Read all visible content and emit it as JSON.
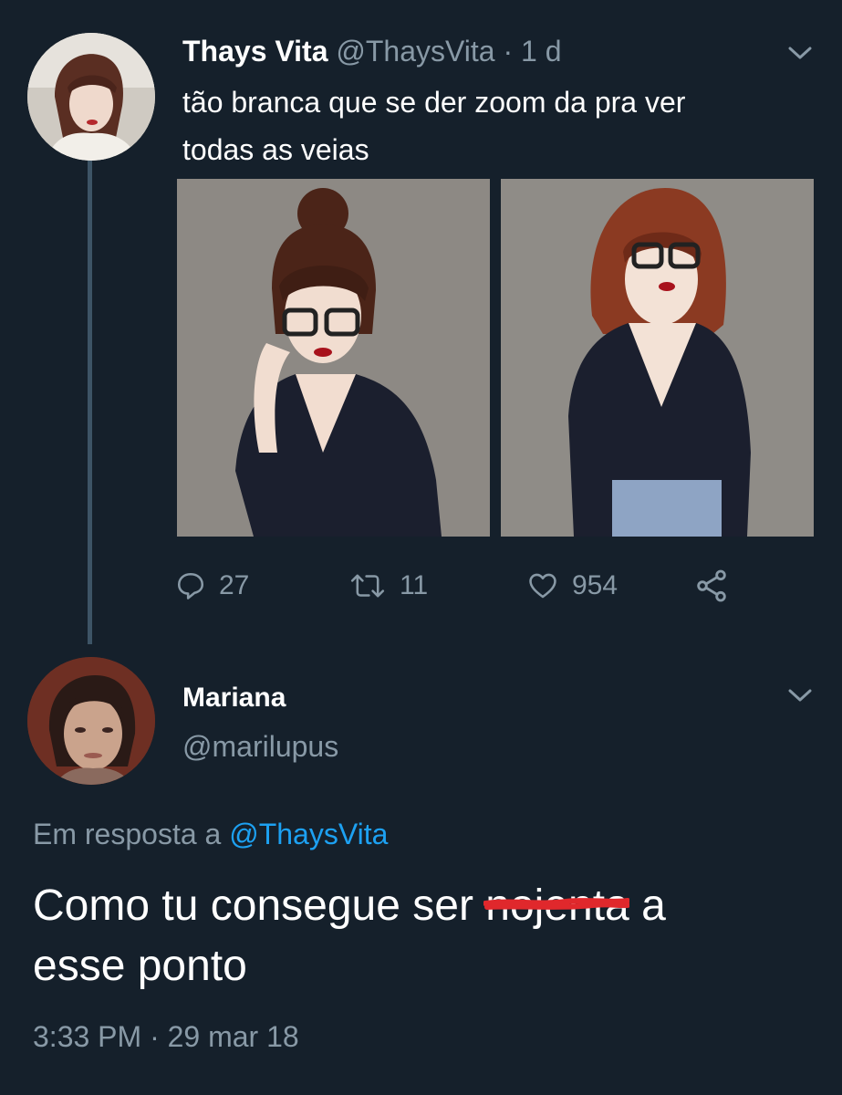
{
  "tweet": {
    "author_name": "Thays Vita",
    "author_handle": "@ThaysVita",
    "separator": "·",
    "time_ago": "1 d",
    "text_line1": "tão branca que se der zoom da pra ver",
    "text_line2": "todas as veias",
    "avatar_icon": "user-avatar-photo",
    "photos": [
      "photo-woman-glasses-bun",
      "photo-woman-glasses-standing"
    ],
    "actions": {
      "reply_icon": "reply-icon",
      "reply_count": "27",
      "retweet_icon": "retweet-icon",
      "retweet_count": "11",
      "like_icon": "heart-icon",
      "like_count": "954",
      "share_icon": "share-icon"
    }
  },
  "reply": {
    "author_name": "Mariana",
    "author_handle": "@marilupus",
    "reply_prefix": "Em resposta a",
    "reply_mention": "@ThaysVita",
    "text_before": "Como tu consegue ser ",
    "text_scribbled": "nojenta",
    "text_after": " a",
    "text_line2": "esse ponto",
    "timestamp": "3:33 PM · 29 mar 18",
    "avatar_icon": "user-avatar-photo"
  },
  "colors": {
    "background": "#15202b",
    "secondary_text": "#8899a6",
    "mention": "#1da1f2",
    "scribble": "#e0282c",
    "thread_line": "#3d5466"
  }
}
